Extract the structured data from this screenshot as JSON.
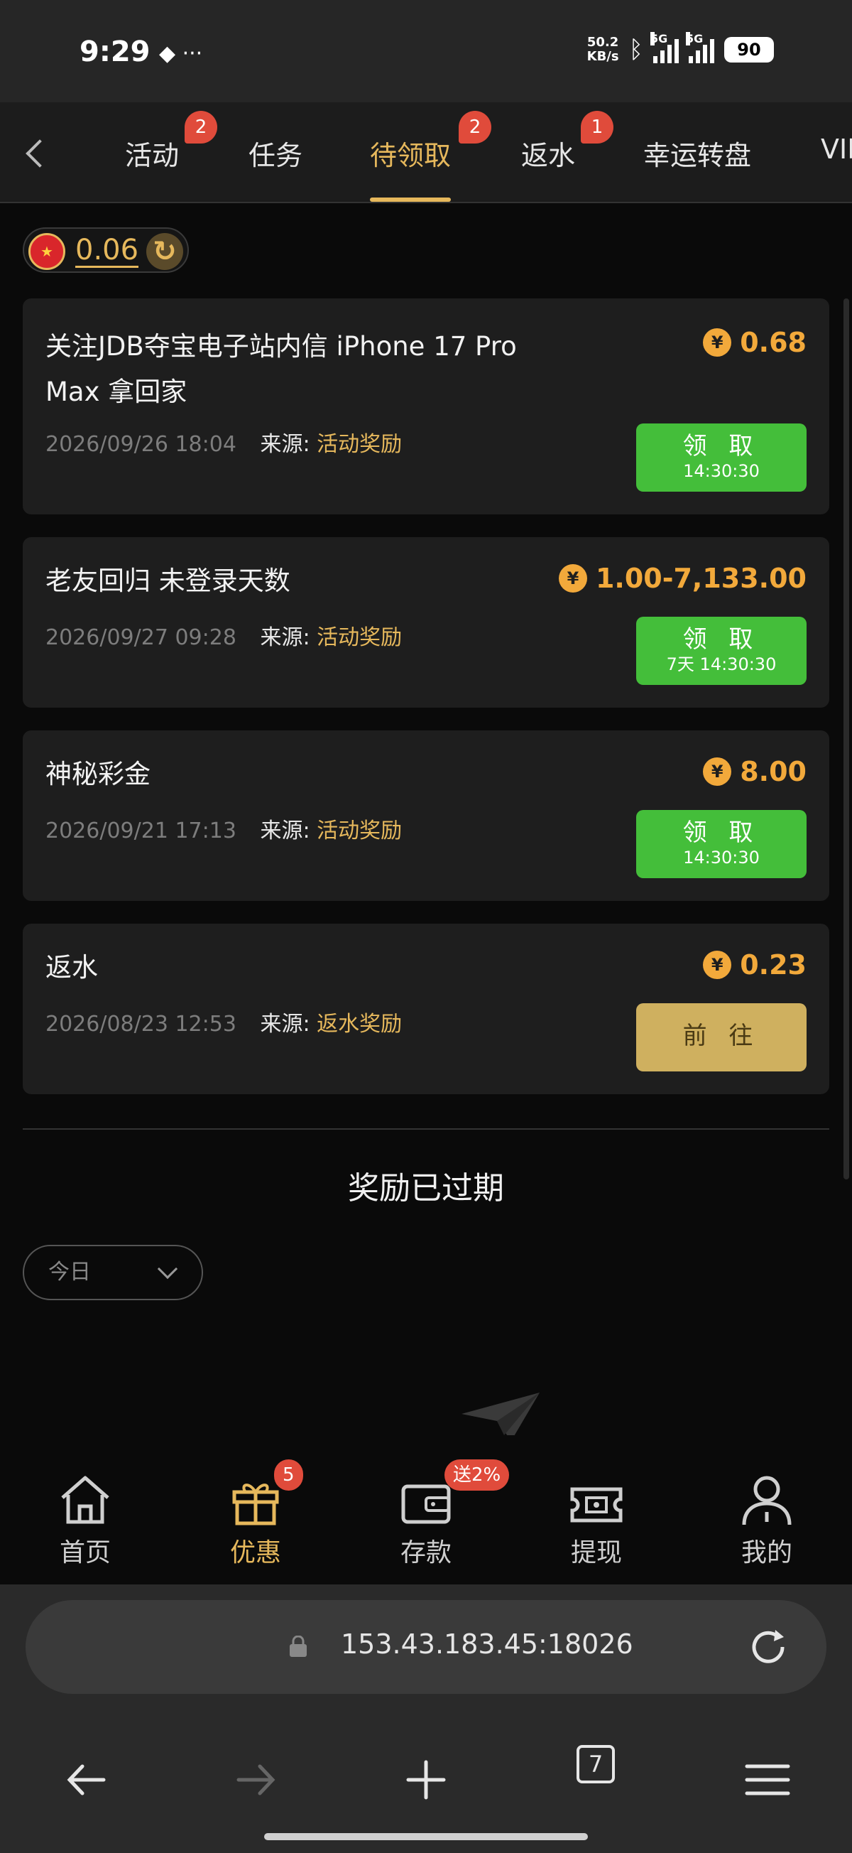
{
  "status_bar": {
    "time": "9:29",
    "net_speed_value": "50.2",
    "net_speed_unit": "KB/s",
    "net_type_1": "5G",
    "net_type_2": "5G",
    "battery": "90"
  },
  "tabs": [
    {
      "label": "活动",
      "badge": "2"
    },
    {
      "label": "任务",
      "badge": ""
    },
    {
      "label": "待领取",
      "badge": "2",
      "active": true
    },
    {
      "label": "返水",
      "badge": "1"
    },
    {
      "label": "幸运转盘",
      "badge": ""
    },
    {
      "label": "VIP",
      "badge": ""
    }
  ],
  "balance": {
    "amount": "0.06"
  },
  "rewards": [
    {
      "title": "关注JDB夺宝电子站内信 iPhone 17 Pro Max 拿回家",
      "date": "2026/09/26 18:04",
      "source_label": "来源:",
      "source": "活动奖励",
      "amount": "0.68",
      "button_label": "领 取",
      "button_sub": "14:30:30"
    },
    {
      "title": "老友回归 未登录天数",
      "date": "2026/09/27 09:28",
      "source_label": "来源:",
      "source": "活动奖励",
      "amount": "1.00-7,133.00",
      "button_label": "领 取",
      "button_sub": "7天 14:30:30"
    },
    {
      "title": "神秘彩金",
      "date": "2026/09/21 17:13",
      "source_label": "来源:",
      "source": "活动奖励",
      "amount": "8.00",
      "button_label": "领 取",
      "button_sub": "14:30:30"
    },
    {
      "title": "返水",
      "date": "2026/08/23 12:53",
      "source_label": "来源:",
      "source": "返水奖励",
      "amount": "0.23",
      "button_label": "前 往",
      "button_sub": ""
    }
  ],
  "coin_symbol": "¥",
  "expired": {
    "title": "奖励已过期",
    "filter": "今日"
  },
  "bottom_nav": [
    {
      "label": "首页",
      "icon": "home-icon",
      "badge": ""
    },
    {
      "label": "优惠",
      "icon": "gift-icon",
      "badge": "5",
      "active": true
    },
    {
      "label": "存款",
      "icon": "wallet-icon",
      "badge": "送2%"
    },
    {
      "label": "提现",
      "icon": "withdraw-icon",
      "badge": ""
    },
    {
      "label": "我的",
      "icon": "user-icon",
      "badge": ""
    }
  ],
  "browser": {
    "url": "153.43.183.45:18026",
    "tab_count": "7"
  },
  "colors": {
    "accent_gold": "#e6b85c",
    "claim_green": "#44be3a",
    "badge_red": "#e04b3b",
    "amount_orange": "#f2a93b"
  }
}
